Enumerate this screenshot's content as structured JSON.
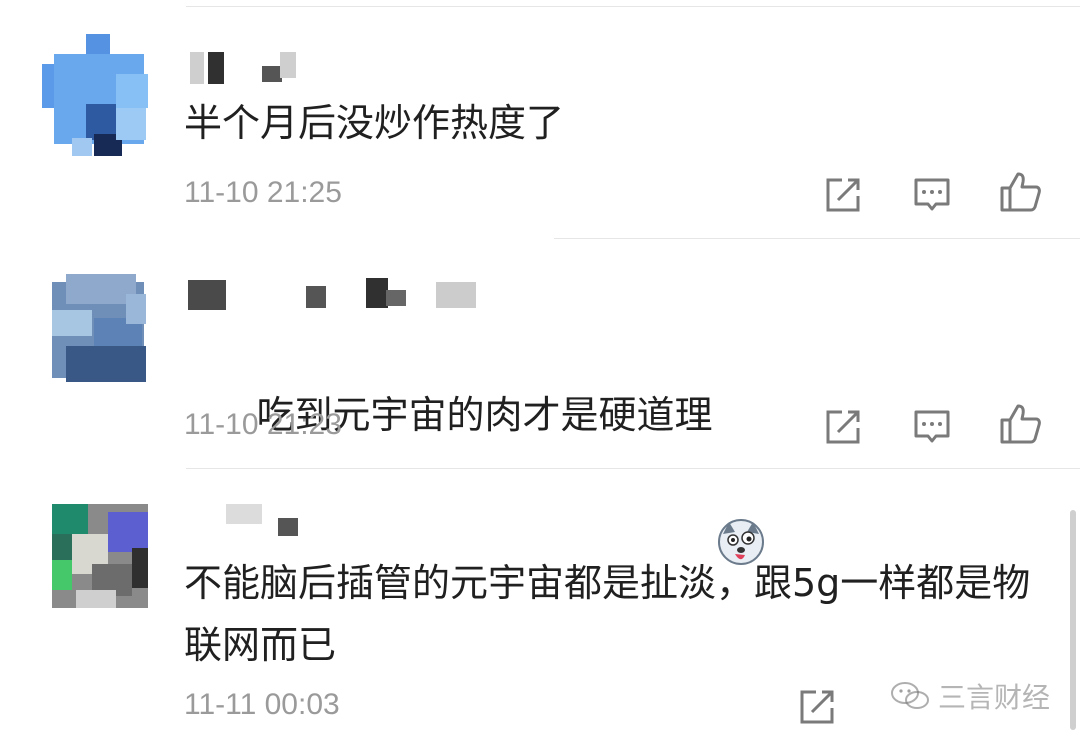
{
  "comments": [
    {
      "text": "半个月后没炒作热度了",
      "time": "11-10 21:25"
    },
    {
      "text": "吃到元宇宙的肉才是硬道理",
      "time": "11-10 21:23",
      "emoji": "husky-dog-emoji"
    },
    {
      "text": "不能脑后插管的元宇宙都是扯淡，跟5g一样都是物联网而已",
      "time": "11-11 00:03"
    }
  ],
  "actions": {
    "share_icon": "share-icon",
    "reply_icon": "reply-icon",
    "like_icon": "thumbs-up-icon"
  },
  "watermark": {
    "text": "三言财经",
    "icon": "wechat-icon"
  },
  "colors": {
    "text": "#202020",
    "time": "#9a9a9a",
    "divider": "#e6e6e6",
    "icon": "#7a7a7a"
  }
}
